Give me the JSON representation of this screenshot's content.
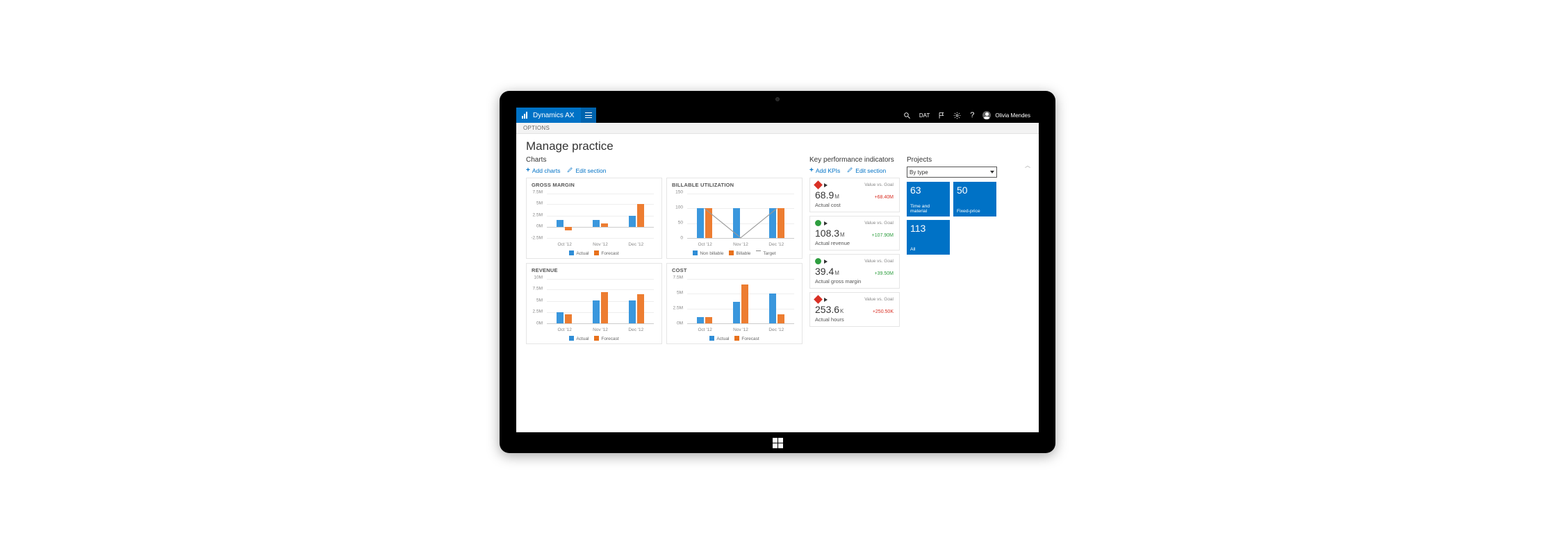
{
  "app": {
    "brand": "Dynamics AX",
    "ribbon_tab": "OPTIONS",
    "dat": "DAT",
    "user": "Olivia Mendes"
  },
  "page": {
    "title": "Manage practice"
  },
  "sections": {
    "charts": {
      "title": "Charts",
      "add": "Add charts",
      "edit": "Edit section"
    },
    "kpi": {
      "title": "Key performance indicators",
      "add": "Add KPIs",
      "edit": "Edit section"
    },
    "projects": {
      "title": "Projects",
      "filter": "By type"
    }
  },
  "charts": {
    "gross_margin": {
      "title": "GROSS MARGIN",
      "legend": [
        "Actual",
        "Forecast"
      ]
    },
    "billable": {
      "title": "BILLABLE UTILIZATION",
      "legend": [
        "Non billable",
        "Billable",
        "Target"
      ]
    },
    "revenue": {
      "title": "REVENUE",
      "legend": [
        "Actual",
        "Forecast"
      ]
    },
    "cost": {
      "title": "COST",
      "legend": [
        "Actual",
        "Forecast"
      ]
    }
  },
  "kpi": [
    {
      "status": "red",
      "value": "68.9",
      "unit": "M",
      "delta": "+68.40M",
      "delta_cls": "red",
      "label": "Actual cost",
      "vgoal": "Value vs. Goal"
    },
    {
      "status": "green",
      "value": "108.3",
      "unit": "M",
      "delta": "+107.90M",
      "delta_cls": "green",
      "label": "Actual revenue",
      "vgoal": "Value vs. Goal"
    },
    {
      "status": "green",
      "value": "39.4",
      "unit": "M",
      "delta": "+39.50M",
      "delta_cls": "green",
      "label": "Actual gross margin",
      "vgoal": "Value vs. Goal"
    },
    {
      "status": "red",
      "value": "253.6",
      "unit": "K",
      "delta": "+250.50K",
      "delta_cls": "red",
      "label": "Actual hours",
      "vgoal": "Value vs. Goal"
    }
  ],
  "tiles": [
    {
      "num": "63",
      "label": "Time and material"
    },
    {
      "num": "50",
      "label": "Fixed-price"
    },
    {
      "num": "113",
      "label": "All"
    }
  ],
  "chart_data": [
    {
      "type": "bar",
      "title": "GROSS MARGIN",
      "categories": [
        "Oct '12",
        "Nov '12",
        "Dec '12"
      ],
      "series": [
        {
          "name": "Actual",
          "values": [
            1.5,
            1.5,
            2.5
          ]
        },
        {
          "name": "Forecast",
          "values": [
            -0.8,
            0.8,
            5.0
          ]
        }
      ],
      "ylabel": "",
      "ylim": [
        -2.5,
        7.5
      ],
      "y_ticks": [
        "7.5M",
        "5M",
        "2.5M",
        "0M",
        "-2.5M"
      ]
    },
    {
      "type": "bar",
      "title": "BILLABLE UTILIZATION",
      "categories": [
        "Oct '12",
        "Nov '12",
        "Dec '12"
      ],
      "series": [
        {
          "name": "Non billable",
          "values": [
            100,
            100,
            100
          ]
        },
        {
          "name": "Billable",
          "values": [
            100,
            0,
            100
          ]
        },
        {
          "name": "Target",
          "values": [
            100,
            0,
            100
          ],
          "render": "line"
        }
      ],
      "ylabel": "",
      "ylim": [
        0,
        150
      ],
      "y_ticks": [
        "150",
        "100",
        "50",
        "0"
      ]
    },
    {
      "type": "bar",
      "title": "REVENUE",
      "categories": [
        "Oct '12",
        "Nov '12",
        "Dec '12"
      ],
      "series": [
        {
          "name": "Actual",
          "values": [
            2.5,
            5.0,
            5.0
          ]
        },
        {
          "name": "Forecast",
          "values": [
            2.0,
            7.0,
            6.5
          ]
        }
      ],
      "ylabel": "",
      "ylim": [
        0,
        10
      ],
      "y_ticks": [
        "10M",
        "7.5M",
        "5M",
        "2.5M",
        "0M"
      ]
    },
    {
      "type": "bar",
      "title": "COST",
      "categories": [
        "Oct '12",
        "Nov '12",
        "Dec '12"
      ],
      "series": [
        {
          "name": "Actual",
          "values": [
            1.0,
            3.5,
            5.0
          ]
        },
        {
          "name": "Forecast",
          "values": [
            1.0,
            6.5,
            1.5
          ]
        }
      ],
      "ylabel": "",
      "ylim": [
        0,
        7.5
      ],
      "y_ticks": [
        "7.5M",
        "5M",
        "2.5M",
        "0M"
      ]
    }
  ]
}
